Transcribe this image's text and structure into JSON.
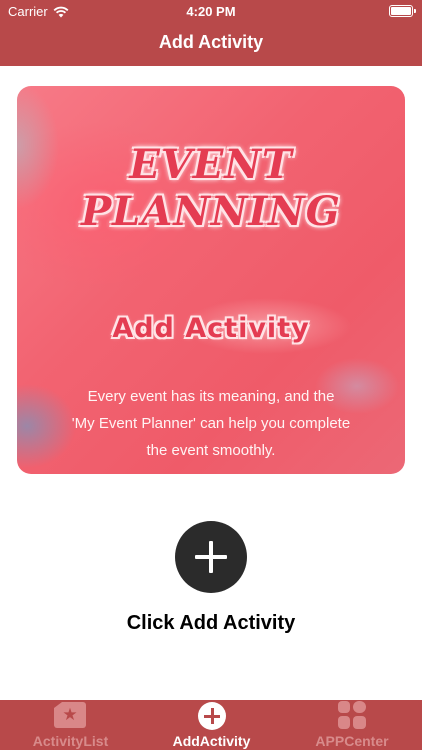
{
  "status_bar": {
    "carrier": "Carrier",
    "time": "4:20 PM"
  },
  "nav": {
    "title": "Add Activity"
  },
  "banner": {
    "logo_text": "EVENT PLANNING",
    "heading": "Add  Activity",
    "description_lines": [
      "Every event has its meaning, and the",
      "'My Event Planner' can help you complete",
      "the event smoothly."
    ]
  },
  "main": {
    "add_label": "Click Add Activity"
  },
  "tabbar": {
    "tabs": [
      {
        "label": "ActivityList",
        "icon": "star-icon",
        "active": false
      },
      {
        "label": "AddActivity",
        "icon": "add-circle-icon",
        "active": true
      },
      {
        "label": "APPCenter",
        "icon": "grid-icon",
        "active": false
      }
    ]
  },
  "colors": {
    "header": "#b8494a",
    "accent_text": "#e43c52",
    "tab_inactive": "#d88b8b"
  }
}
